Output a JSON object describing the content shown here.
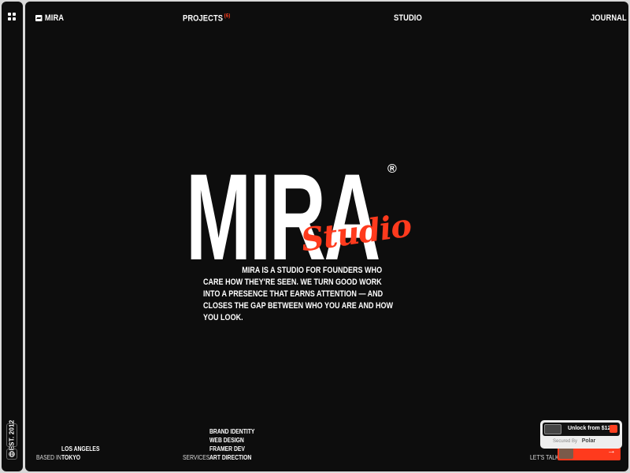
{
  "rail": {
    "est_label": "EST. 2012"
  },
  "nav": {
    "logo": "MIRA",
    "projects": "PROJECTS",
    "projects_count": "(6)",
    "studio": "STUDIO",
    "journal": "JOURNAL"
  },
  "hero": {
    "title": "MIRA",
    "registered": "®",
    "script": "Studio",
    "intro": "MIRA IS A STUDIO FOR FOUNDERS WHO CARE HOW THEY'RE SEEN. WE TURN GOOD WORK INTO A PRESENCE THAT EARNS ATTENTION — AND CLOSES THE GAP BETWEEN WHO YOU ARE AND HOW YOU LOOK."
  },
  "footer": {
    "based_label": "BASED IN",
    "based_values": [
      "LOS ANGELES",
      "TOKYO"
    ],
    "services_label": "SERVICES",
    "services_values": [
      "BRAND IDENTITY",
      "WEB DESIGN",
      "FRAMER DEV",
      "ART DIRECTION"
    ],
    "talk_label": "LET'S TALK",
    "talk_arrow": "→"
  },
  "polar": {
    "unlock": "Unlock from $129",
    "secured": "Secured By",
    "brand": "Polar"
  },
  "colors": {
    "background": "#0d0d0d",
    "accent": "#ff3a1d",
    "text": "#ffffff"
  }
}
